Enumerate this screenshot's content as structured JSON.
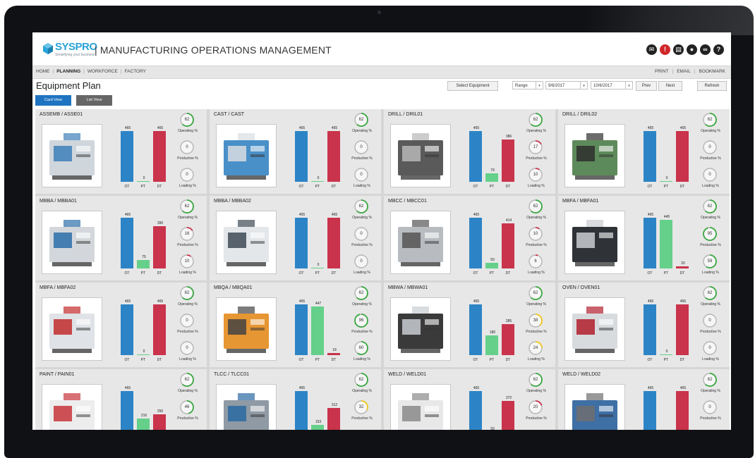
{
  "app": {
    "logo_text": "SYSPRO",
    "logo_tagline": "Simplifying your business",
    "title": "| MANUFACTURING OPERATIONS MANAGEMENT"
  },
  "header_icons": [
    "mail-icon",
    "alert-icon",
    "document-icon",
    "user-icon",
    "link-icon",
    "help-icon"
  ],
  "nav": {
    "left": [
      "HOME",
      "PLANNING",
      "WORKFORCE",
      "FACTORY"
    ],
    "active": "PLANNING",
    "right": [
      "PRINT",
      "EMAIL",
      "BOOKMARK"
    ]
  },
  "toolbar": {
    "page_title": "Equipment Plan",
    "select_equipment": "Select Equipment",
    "range_value": "Range",
    "from_date": "9/6/2017",
    "to_date": "10/6/2017",
    "prev": "Prev",
    "next": "Next",
    "refresh": "Refresh"
  },
  "view_tabs": {
    "card_view": "Card View",
    "list_view": "List View"
  },
  "labels": {
    "ot": "OT",
    "pt": "PT",
    "dt": "DT",
    "operating": "Operating %",
    "productive": "Productive %",
    "loading": "Loading %"
  },
  "colors": {
    "ot": "#2c84c6",
    "pt": "#65d08a",
    "dt": "#c9334b",
    "gauge_green": "#3aa640",
    "gauge_red": "#c9334b",
    "gauge_yellow": "#f0c419",
    "accent": "#1f74c1"
  },
  "cards": [
    {
      "title": "ASSEMB / ASSE01",
      "ot": 465,
      "pt": 0,
      "dt": 465,
      "operating": 62,
      "productive": 0,
      "loading": 0,
      "pt_label": "0"
    },
    {
      "title": "CAST / CAST",
      "ot": 465,
      "pt": 0,
      "dt": 465,
      "operating": 62,
      "productive": 0,
      "loading": 0,
      "pt_label": "0"
    },
    {
      "title": "DRILL / DRIL01",
      "ot": 465,
      "pt": 79,
      "dt": 386,
      "operating": 62,
      "productive": 17,
      "loading": 10,
      "pt_label": "79"
    },
    {
      "title": "DRILL / DRIL02",
      "ot": 465,
      "pt": 0,
      "dt": 465,
      "operating": 62,
      "productive": 0,
      "loading": 0,
      "pt_label": "0"
    },
    {
      "title": "MBBA / MBBA01",
      "ot": 465,
      "pt": 75,
      "dt": 390,
      "operating": 62,
      "productive": 16,
      "loading": 10,
      "pt_label": "75"
    },
    {
      "title": "MBBA / MBBA02",
      "ot": 465,
      "pt": 0,
      "dt": 465,
      "operating": 62,
      "productive": 0,
      "loading": 0,
      "pt_label": "0"
    },
    {
      "title": "MBCC / MBCC01",
      "ot": 465,
      "pt": 50,
      "dt": 414,
      "operating": 62,
      "productive": 10,
      "loading": 6,
      "pt_label": "50"
    },
    {
      "title": "MBFA / MBFA01",
      "ot": 465,
      "pt": 445,
      "dt": 20,
      "operating": 62,
      "productive": 95,
      "loading": 59,
      "pt_label": "445"
    },
    {
      "title": "MBFA / MBFA02",
      "ot": 465,
      "pt": 0,
      "dt": 465,
      "operating": 62,
      "productive": 0,
      "loading": 0,
      "pt_label": "0"
    },
    {
      "title": "MBQA / MBQA01",
      "ot": 465,
      "pt": 447,
      "dt": 18,
      "operating": 62,
      "productive": 96,
      "loading": 60,
      "pt_label": "447"
    },
    {
      "title": "MBWA / MBWA01",
      "ot": 465,
      "pt": 180,
      "dt": 285,
      "operating": 62,
      "productive": 38,
      "loading": 24,
      "pt_label": "180"
    },
    {
      "title": "OVEN / OVEN01",
      "ot": 465,
      "pt": 0,
      "dt": 465,
      "operating": 62,
      "productive": 0,
      "loading": 0,
      "pt_label": "0"
    },
    {
      "title": "PAINT / PAIN01",
      "ot": 465,
      "pt": 216,
      "dt": 250,
      "operating": 62,
      "productive": 46,
      "loading": null,
      "pt_label": "216"
    },
    {
      "title": "TLCC / TLCC01",
      "ot": 465,
      "pt": 153,
      "dt": 312,
      "operating": 62,
      "productive": 32,
      "loading": null,
      "pt_label": "153"
    },
    {
      "title": "WELD / WELD01",
      "ot": 465,
      "pt": 93,
      "dt": 372,
      "operating": 62,
      "productive": 20,
      "loading": null,
      "pt_label": "93"
    },
    {
      "title": "WELD / WELD02",
      "ot": 465,
      "pt": 0,
      "dt": 465,
      "operating": 62,
      "productive": 0,
      "loading": null,
      "pt_label": "0"
    }
  ]
}
